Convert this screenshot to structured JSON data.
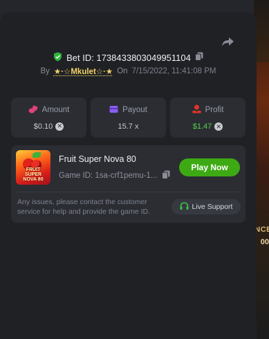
{
  "bet": {
    "id_label": "Bet ID: 1738433803049951104",
    "by_label": "By",
    "username": "★·☆Mkulet☆·★",
    "on_label": "On",
    "date": "7/15/2022, 11:41:08 PM"
  },
  "stats": [
    {
      "label": "Amount",
      "value": "$0.10"
    },
    {
      "label": "Payout",
      "value": "15.7 x"
    },
    {
      "label": "Profit",
      "value": "$1.47"
    }
  ],
  "game": {
    "title": "Fruit Super Nova 80",
    "id_label": "Game ID: 1sa-crf1pemu-1...",
    "play_label": "Play Now",
    "thumb_text": "FRUIT SUPER NOVA 80",
    "issue_text": "Any issues, please contact the customer service for help and provide the game ID.",
    "support_label": "Live Support"
  },
  "background": {
    "right_text_1": "NCE",
    "right_text_2": "00"
  },
  "colors": {
    "accent_green": "#3daa14",
    "profit_green": "#58d04a",
    "username_gold": "#f4d36a"
  }
}
